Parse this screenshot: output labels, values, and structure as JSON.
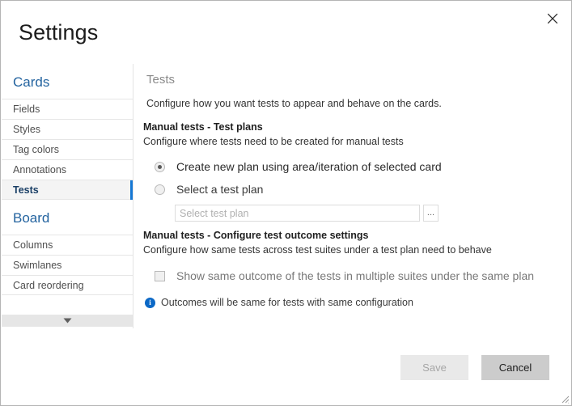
{
  "window": {
    "title": "Settings",
    "close_icon": "close-x-icon"
  },
  "sidebar": {
    "groups": [
      {
        "title": "Cards",
        "items": [
          {
            "label": "Fields",
            "selected": false
          },
          {
            "label": "Styles",
            "selected": false
          },
          {
            "label": "Tag colors",
            "selected": false
          },
          {
            "label": "Annotations",
            "selected": false
          },
          {
            "label": "Tests",
            "selected": true
          }
        ]
      },
      {
        "title": "Board",
        "items": [
          {
            "label": "Columns",
            "selected": false
          },
          {
            "label": "Swimlanes",
            "selected": false
          },
          {
            "label": "Card reordering",
            "selected": false
          }
        ]
      }
    ],
    "scroll_down_icon": "chevron-down-icon"
  },
  "main": {
    "section_title": "Tests",
    "section_description": "Configure how you want tests to appear and behave on the cards.",
    "test_plans": {
      "heading": "Manual tests - Test plans",
      "subtext": "Configure where tests need to be created for manual tests",
      "options": [
        {
          "label": "Create new plan using area/iteration of selected card",
          "selected": true
        },
        {
          "label": "Select a test plan",
          "selected": false
        }
      ],
      "test_plan_field": {
        "value": "",
        "placeholder": "Select test plan",
        "browse_label": "..."
      }
    },
    "outcome_settings": {
      "heading": "Manual tests - Configure test outcome settings",
      "subtext": "Configure how same tests across test suites under a test plan need to behave",
      "checkbox": {
        "label": "Show same outcome of the tests in multiple suites under the same plan",
        "checked": false
      },
      "info": {
        "icon": "info-icon",
        "glyph": "i",
        "text": "Outcomes will be same for tests with same configuration"
      }
    }
  },
  "footer": {
    "save_label": "Save",
    "cancel_label": "Cancel"
  },
  "colors": {
    "accent_blue": "#1477d4",
    "group_title_blue": "#23639f",
    "info_blue": "#0b68c6",
    "selected_item_bg": "#f4f4f4"
  }
}
